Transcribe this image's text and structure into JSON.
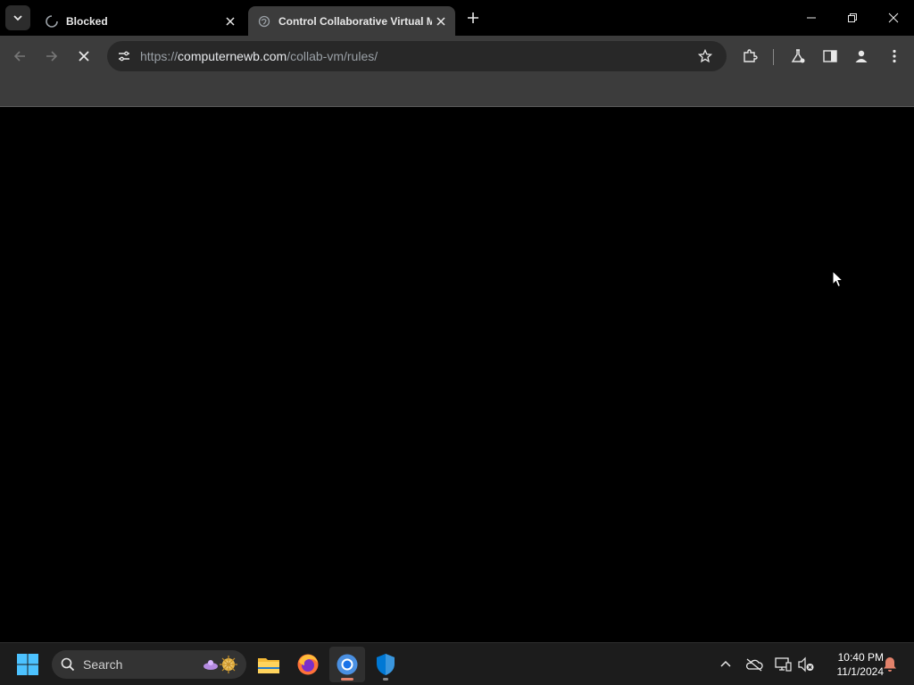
{
  "browser": {
    "tabs": [
      {
        "title": "Blocked",
        "active": false,
        "favicon": "loading-spinner-icon"
      },
      {
        "title": "Control Collaborative Virtual M",
        "active": true,
        "favicon": "globe-icon"
      }
    ],
    "url": {
      "scheme": "https://",
      "host": "computernewb.com",
      "path": "/collab-vm/rules/"
    }
  },
  "taskbar": {
    "search_placeholder": "Search",
    "apps": [
      "file-explorer",
      "firefox",
      "chrome",
      "windows-security"
    ],
    "active_app": "chrome"
  },
  "clock": {
    "time": "10:40 PM",
    "date": "11/1/2024"
  },
  "colors": {
    "accent": "#e2826b",
    "toolbar": "#3c3c3c",
    "omnibox": "#282828",
    "taskbar": "#1c1c1c"
  }
}
